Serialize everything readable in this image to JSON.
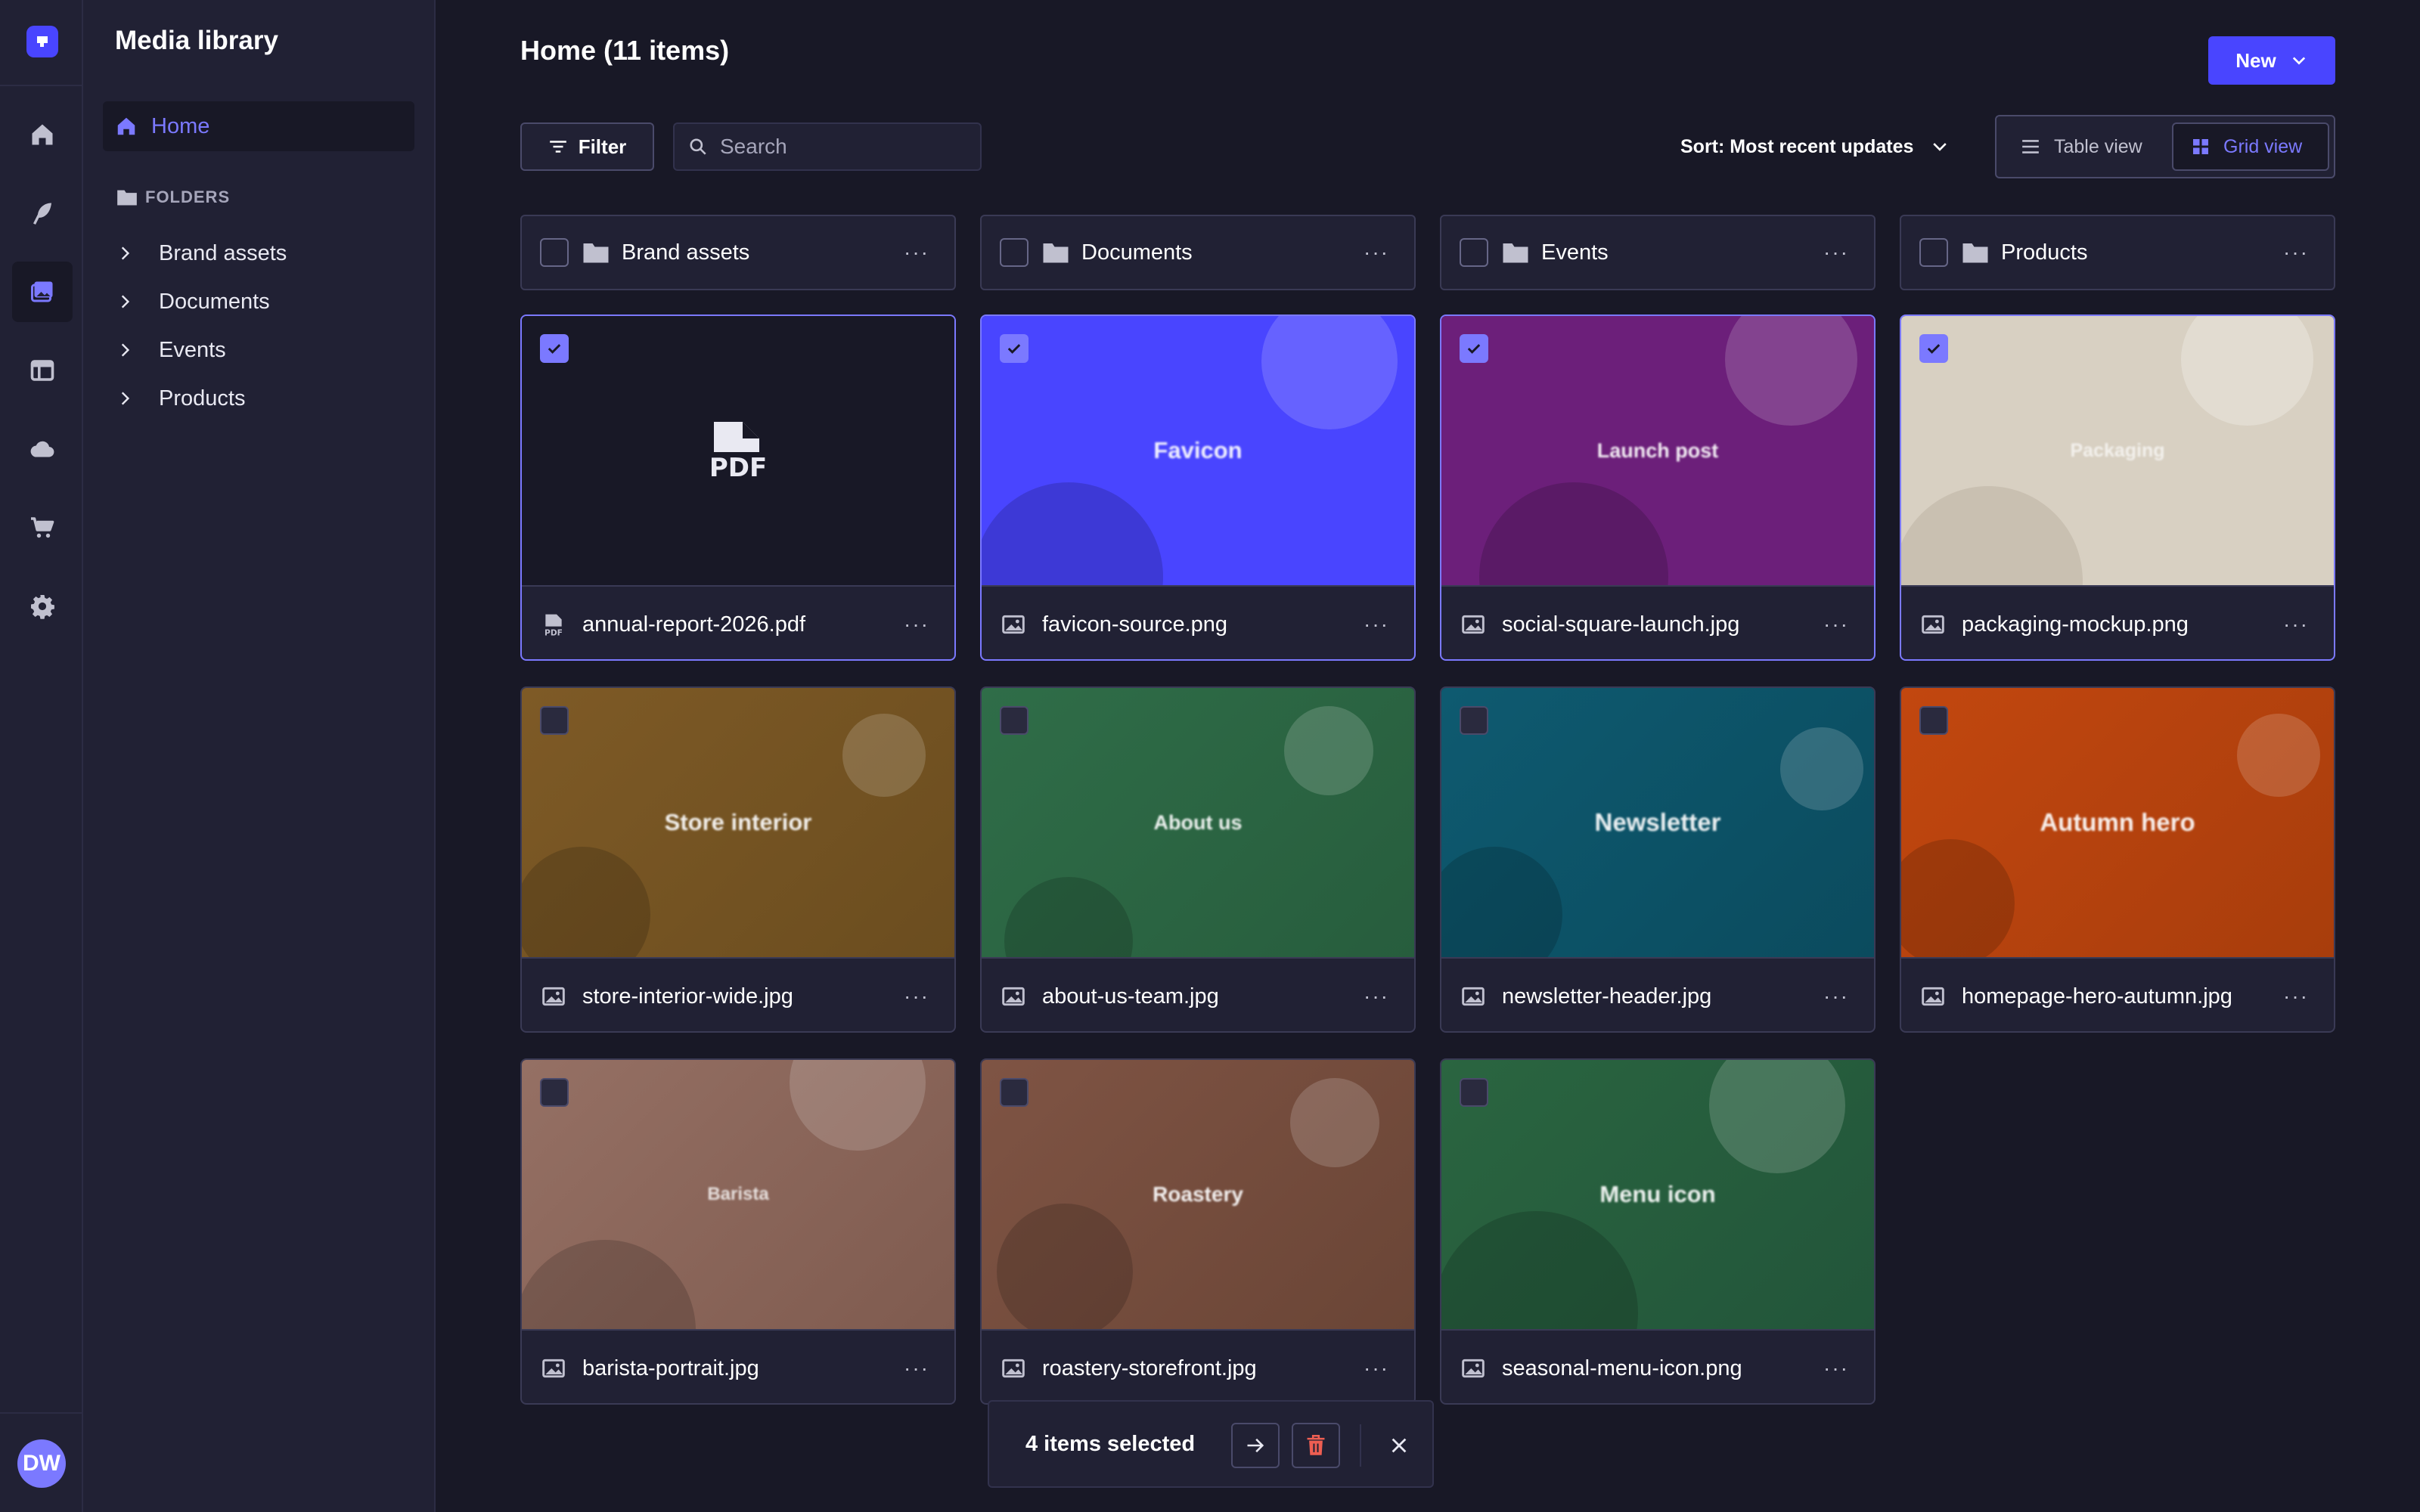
{
  "app": {
    "title": "Media library",
    "avatar_initials": "DW",
    "accent": "#4945ff"
  },
  "rail": {
    "items": [
      {
        "icon": "home-icon"
      },
      {
        "icon": "feather-icon"
      },
      {
        "icon": "media-library-icon"
      },
      {
        "icon": "layout-icon"
      },
      {
        "icon": "cloud-icon"
      },
      {
        "icon": "cart-icon"
      },
      {
        "icon": "gear-icon"
      }
    ]
  },
  "sidebar": {
    "home_label": "Home",
    "folders_heading": "FOLDERS",
    "folders": [
      "Brand assets",
      "Documents",
      "Events",
      "Products"
    ]
  },
  "header": {
    "title": "Home (11 items)",
    "new_label": "New",
    "filter_label": "Filter",
    "search_placeholder": "Search",
    "sort_label": "Sort: Most recent updates",
    "table_view_label": "Table view",
    "grid_view_label": "Grid view"
  },
  "folder_cards": [
    "Brand assets",
    "Documents",
    "Events",
    "Products"
  ],
  "assets": [
    {
      "file": "annual-report-2026.pdf",
      "preview": "PDF",
      "type": "pdf",
      "selected": true,
      "color": "#181826"
    },
    {
      "file": "favicon-source.png",
      "preview": "Favicon",
      "type": "image",
      "selected": true,
      "color": "#4945ff"
    },
    {
      "file": "social-square-launch.jpg",
      "preview": "Launch post",
      "type": "image",
      "selected": true,
      "color": "#6c1f7a"
    },
    {
      "file": "packaging-mockup.png",
      "preview": "Packaging",
      "type": "image",
      "selected": true,
      "color": "#d8d0c2"
    },
    {
      "file": "store-interior-wide.jpg",
      "preview": "Store interior",
      "type": "image",
      "selected": false,
      "color": "#7e5a26"
    },
    {
      "file": "about-us-team.jpg",
      "preview": "About us",
      "type": "image",
      "selected": false,
      "color": "#2f6d48"
    },
    {
      "file": "newsletter-header.jpg",
      "preview": "Newsletter",
      "type": "image",
      "selected": false,
      "color": "#0e5a70"
    },
    {
      "file": "homepage-hero-autumn.jpg",
      "preview": "Autumn hero",
      "type": "image",
      "selected": false,
      "color": "#b8400e"
    },
    {
      "file": "barista-portrait.jpg",
      "preview": "Barista",
      "type": "image",
      "selected": false,
      "color": "#8c6659"
    },
    {
      "file": "roastery-storefront.jpg",
      "preview": "Roastery",
      "type": "image",
      "selected": false,
      "color": "#7a4f3e"
    },
    {
      "file": "seasonal-menu-icon.png",
      "preview": "Menu icon",
      "type": "image",
      "selected": false,
      "color": "#245a38"
    }
  ],
  "selection_bar": {
    "label": "4 items selected"
  }
}
